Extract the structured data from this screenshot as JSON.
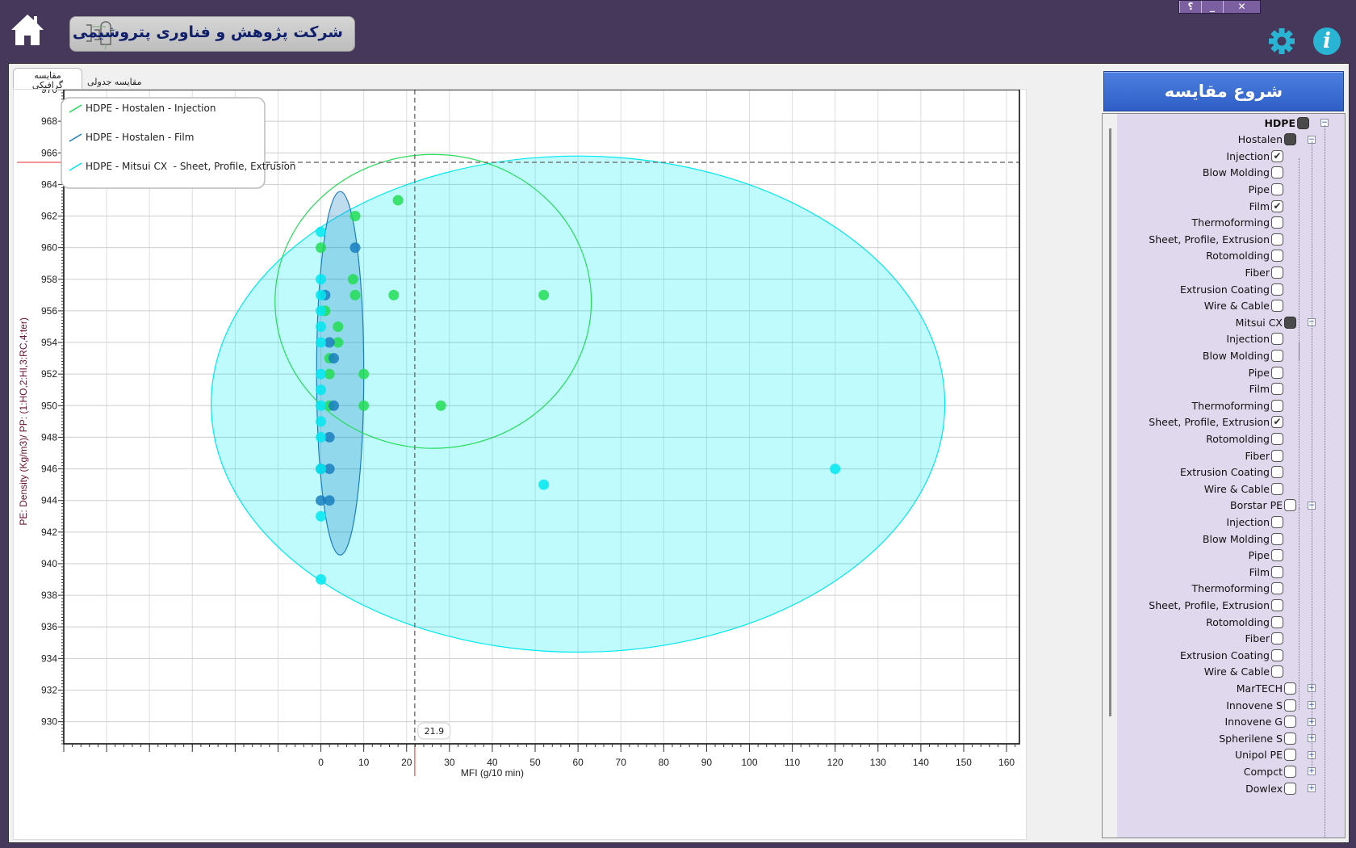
{
  "window": {
    "buttons": [
      "؟",
      "_",
      "✕"
    ]
  },
  "header": {
    "title": "شرکت پژوهش و فناوری پتروشیمی",
    "icons": [
      "home-icon",
      "gear-icon",
      "info-icon"
    ],
    "info_glyph": "i"
  },
  "tabs": [
    {
      "label": "مقایسه گرافیکی",
      "active": true
    },
    {
      "label": "مقایسه جدولی",
      "active": false
    }
  ],
  "start_button": "شروع مقایسه",
  "tree": [
    {
      "label": "HDPE",
      "level": 0,
      "state": "filled",
      "expander": "-",
      "bold": true
    },
    {
      "label": "Hostalen",
      "level": 1,
      "state": "filled",
      "expander": "-"
    },
    {
      "label": "Injection",
      "level": 2,
      "state": "checked"
    },
    {
      "label": "Blow Molding",
      "level": 2,
      "state": "empty"
    },
    {
      "label": "Pipe",
      "level": 2,
      "state": "empty"
    },
    {
      "label": "Film",
      "level": 2,
      "state": "checked"
    },
    {
      "label": "Thermoforming",
      "level": 2,
      "state": "empty"
    },
    {
      "label": "Sheet, Profile, Extrusion",
      "level": 2,
      "state": "empty"
    },
    {
      "label": "Rotomolding",
      "level": 2,
      "state": "empty"
    },
    {
      "label": "Fiber",
      "level": 2,
      "state": "empty"
    },
    {
      "label": "Extrusion Coating",
      "level": 2,
      "state": "empty"
    },
    {
      "label": "Wire & Cable",
      "level": 2,
      "state": "empty"
    },
    {
      "label": "Mitsui CX",
      "level": 1,
      "state": "filled",
      "expander": "-"
    },
    {
      "label": "Injection",
      "level": 2,
      "state": "empty"
    },
    {
      "label": "Blow Molding",
      "level": 2,
      "state": "empty"
    },
    {
      "label": "Pipe",
      "level": 2,
      "state": "empty"
    },
    {
      "label": "Film",
      "level": 2,
      "state": "empty"
    },
    {
      "label": "Thermoforming",
      "level": 2,
      "state": "empty"
    },
    {
      "label": "Sheet, Profile, Extrusion",
      "level": 2,
      "state": "checked"
    },
    {
      "label": "Rotomolding",
      "level": 2,
      "state": "empty"
    },
    {
      "label": "Fiber",
      "level": 2,
      "state": "empty"
    },
    {
      "label": "Extrusion Coating",
      "level": 2,
      "state": "empty"
    },
    {
      "label": "Wire & Cable",
      "level": 2,
      "state": "empty"
    },
    {
      "label": "Borstar PE",
      "level": 1,
      "state": "empty",
      "expander": "-"
    },
    {
      "label": "Injection",
      "level": 2,
      "state": "empty"
    },
    {
      "label": "Blow Molding",
      "level": 2,
      "state": "empty"
    },
    {
      "label": "Pipe",
      "level": 2,
      "state": "empty"
    },
    {
      "label": "Film",
      "level": 2,
      "state": "empty"
    },
    {
      "label": "Thermoforming",
      "level": 2,
      "state": "empty"
    },
    {
      "label": "Sheet, Profile, Extrusion",
      "level": 2,
      "state": "empty"
    },
    {
      "label": "Rotomolding",
      "level": 2,
      "state": "empty"
    },
    {
      "label": "Fiber",
      "level": 2,
      "state": "empty"
    },
    {
      "label": "Extrusion Coating",
      "level": 2,
      "state": "empty"
    },
    {
      "label": "Wire & Cable",
      "level": 2,
      "state": "empty"
    },
    {
      "label": "MarTECH",
      "level": 1,
      "state": "empty",
      "expander": "+"
    },
    {
      "label": "Innovene S",
      "level": 1,
      "state": "empty",
      "expander": "+"
    },
    {
      "label": "Innovene G",
      "level": 1,
      "state": "empty",
      "expander": "+"
    },
    {
      "label": "Spherilene S",
      "level": 1,
      "state": "empty",
      "expander": "+"
    },
    {
      "label": "Unipol PE",
      "level": 1,
      "state": "empty",
      "expander": "+"
    },
    {
      "label": "Compct",
      "level": 1,
      "state": "empty",
      "expander": "+"
    },
    {
      "label": "Dowlex",
      "level": 1,
      "state": "empty",
      "expander": "+"
    }
  ],
  "chart_data": {
    "type": "scatter",
    "xlabel": "MFI (g/10 min)",
    "ylabel": "PE: Density (Kg/m3)/ PP: (1:HO,2:HI,3:RC,4:ter)",
    "xlim": [
      -60,
      163
    ],
    "ylim": [
      928.6,
      970
    ],
    "xticks": [
      0,
      10,
      20,
      30,
      40,
      50,
      60,
      70,
      80,
      90,
      100,
      110,
      120,
      130,
      140,
      150,
      160
    ],
    "yticks": [
      930,
      932,
      934,
      936,
      938,
      940,
      942,
      944,
      946,
      948,
      950,
      952,
      954,
      956,
      958,
      960,
      962,
      964,
      966,
      968,
      970
    ],
    "grid": true,
    "legend_position": "top-left",
    "crosshair": {
      "x": 21.9,
      "y": 965.4,
      "x_label": "21.9"
    },
    "series": [
      {
        "name": "HDPE - Hostalen - Injection",
        "color": "#22dd55",
        "ellipse": {
          "cx": 26.2,
          "cy": 956.6,
          "rx": 36.9,
          "ry": 9.3,
          "fill": "none"
        },
        "points": [
          [
            0,
            960
          ],
          [
            8,
            962
          ],
          [
            18,
            963
          ],
          [
            7.5,
            958
          ],
          [
            8,
            957
          ],
          [
            17,
            957
          ],
          [
            52,
            957
          ],
          [
            4,
            955
          ],
          [
            4,
            954
          ],
          [
            2,
            953
          ],
          [
            2,
            952
          ],
          [
            10,
            952
          ],
          [
            10,
            950
          ],
          [
            28,
            950
          ],
          [
            1,
            956
          ],
          [
            2,
            950
          ]
        ]
      },
      {
        "name": "HDPE - Hostalen - Film",
        "color": "#1a7fc0",
        "ellipse": {
          "cx": 4.5,
          "cy": 952.05,
          "rx": 5.5,
          "ry": 11.5,
          "fill": "rgba(40,140,200,0.3)"
        },
        "points": [
          [
            8,
            960
          ],
          [
            1,
            957
          ],
          [
            2,
            954
          ],
          [
            3,
            953
          ],
          [
            3,
            950
          ],
          [
            2,
            948
          ],
          [
            0,
            946
          ],
          [
            2,
            946
          ],
          [
            0,
            944
          ],
          [
            2,
            944
          ]
        ]
      },
      {
        "name": "HDPE - Mitsui CX  - Sheet, Profile, Extrusion",
        "color": "#00e8f0",
        "ellipse": {
          "cx": 60,
          "cy": 950.1,
          "rx": 85.6,
          "ry": 15.7,
          "fill": "rgba(0,235,245,0.25)"
        },
        "points": [
          [
            0,
            961
          ],
          [
            0,
            958
          ],
          [
            0,
            957
          ],
          [
            0,
            956
          ],
          [
            0,
            955
          ],
          [
            0,
            954
          ],
          [
            0,
            952
          ],
          [
            0,
            951
          ],
          [
            0,
            950
          ],
          [
            0,
            949
          ],
          [
            0,
            948
          ],
          [
            0,
            946
          ],
          [
            0,
            943
          ],
          [
            0,
            939
          ],
          [
            52,
            945
          ],
          [
            120,
            946
          ]
        ]
      }
    ]
  }
}
